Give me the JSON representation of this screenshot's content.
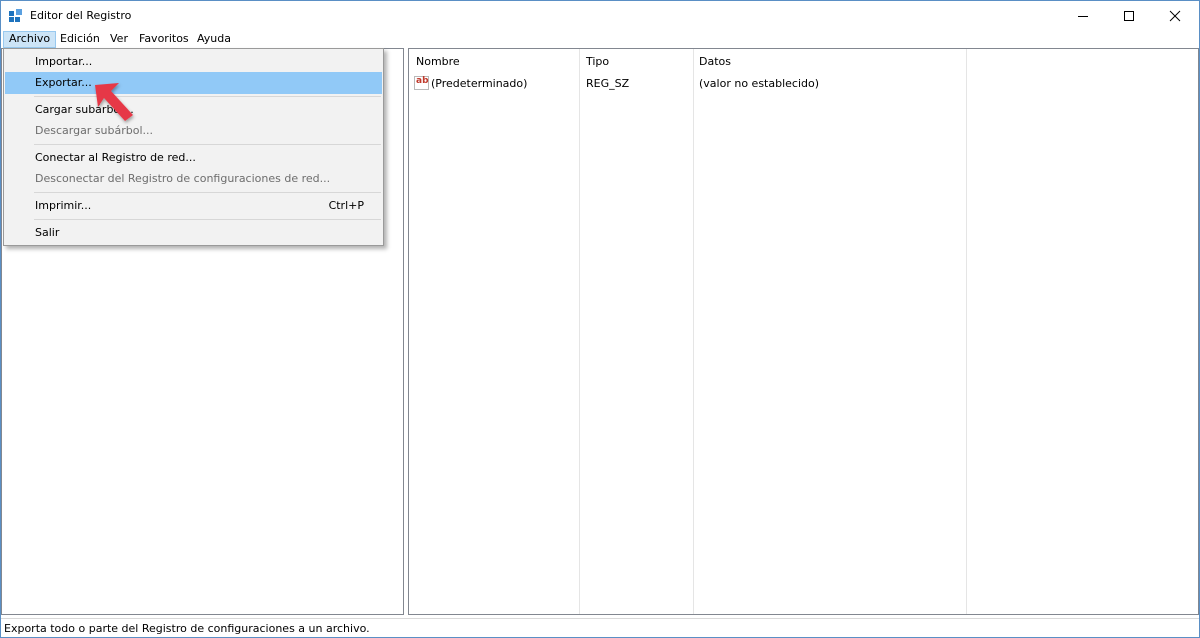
{
  "window": {
    "title": "Editor del Registro"
  },
  "menubar": {
    "items": [
      "Archivo",
      "Edición",
      "Ver",
      "Favoritos",
      "Ayuda"
    ]
  },
  "file_menu": {
    "items": [
      {
        "label": "Importar...",
        "enabled": true
      },
      {
        "label": "Exportar...",
        "enabled": true,
        "highlighted": true
      },
      {
        "label": "Cargar subárbol...",
        "enabled": true
      },
      {
        "label": "Descargar subárbol...",
        "enabled": false
      },
      {
        "label": "Conectar al Registro de red...",
        "enabled": true
      },
      {
        "label": "Desconectar del Registro de configuraciones de red...",
        "enabled": false
      },
      {
        "label": "Imprimir...",
        "enabled": true,
        "shortcut": "Ctrl+P"
      },
      {
        "label": "Salir",
        "enabled": true
      }
    ]
  },
  "values_table": {
    "columns": [
      "Nombre",
      "Tipo",
      "Datos"
    ],
    "rows": [
      {
        "name": "(Predeterminado)",
        "type": "REG_SZ",
        "data": "(valor no establecido)",
        "icon": "ab"
      }
    ]
  },
  "statusbar": {
    "text": "Exporta todo o parte del Registro de configuraciones a un archivo."
  },
  "colors": {
    "highlight": "#91c9f7",
    "menu_active": "#cce4f7",
    "arrow": "#e63946"
  }
}
